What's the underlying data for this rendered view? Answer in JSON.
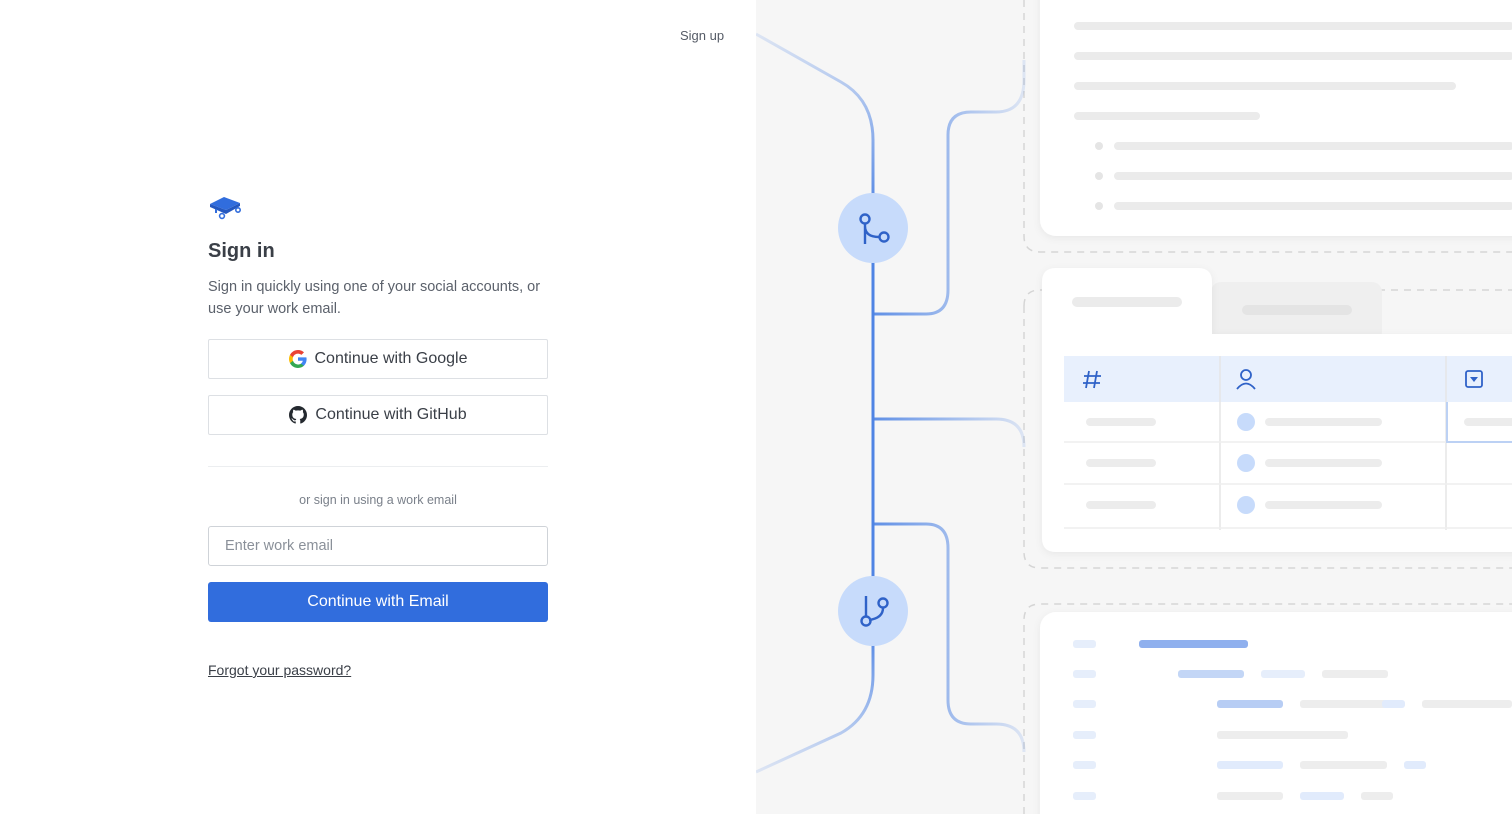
{
  "header": {
    "signup_label": "Sign up"
  },
  "signin": {
    "title": "Sign in",
    "subtitle": "Sign in quickly using one of your social accounts, or use your work email.",
    "google_label": "Continue with Google",
    "github_label": "Continue with GitHub",
    "divider_text": "or sign in using a work email",
    "email_placeholder": "Enter work email",
    "email_value": "",
    "email_button_label": "Continue with Email",
    "forgot_label": "Forgot your password?"
  },
  "icons": {
    "logo": "book-logo-icon",
    "google": "google-icon",
    "github": "github-icon",
    "merge": "git-merge-icon",
    "branch": "git-branch-icon",
    "hash": "hash-icon",
    "person": "person-icon",
    "dropdown": "dropdown-box-icon"
  },
  "colors": {
    "primary": "#316ddd",
    "accent_light": "#c7dbfb",
    "line": "#4f84e4",
    "illustration_bg": "#f6f6f6"
  }
}
